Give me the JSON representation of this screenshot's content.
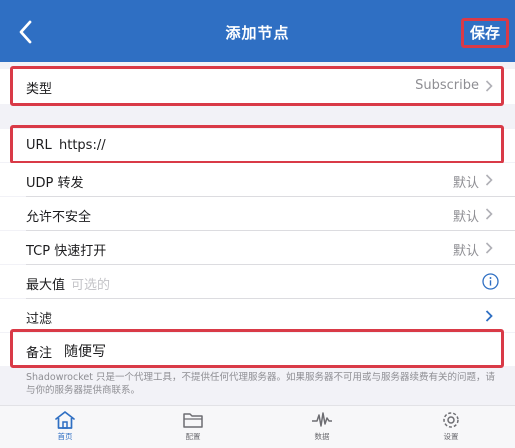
{
  "nav": {
    "title": "添加节点",
    "save_label": "保存"
  },
  "type_row": {
    "label": "类型",
    "value": "Subscribe"
  },
  "url_row": {
    "label": "URL",
    "value": "https://"
  },
  "udp_row": {
    "label": "UDP 转发",
    "value": "默认"
  },
  "insecure_row": {
    "label": "允许不安全",
    "value": "默认"
  },
  "tcp_row": {
    "label": "TCP 快速打开",
    "value": "默认"
  },
  "max_row": {
    "label": "最大值",
    "placeholder": "可选的"
  },
  "filter_row": {
    "label": "过滤"
  },
  "remark_row": {
    "label": "备注",
    "value": "随便写"
  },
  "footer_note": "Shadowrocket 只是一个代理工具，不提供任何代理服务器。如果服务器不可用或与服务器续费有关的问题，请与你的服务器提供商联系。",
  "tabs": [
    {
      "label": "首页",
      "icon": "home-icon",
      "active": true
    },
    {
      "label": "配置",
      "icon": "folder-icon",
      "active": false
    },
    {
      "label": "数据",
      "icon": "pulse-icon",
      "active": false
    },
    {
      "label": "设置",
      "icon": "gear-icon",
      "active": false
    }
  ],
  "colors": {
    "nav_blue": "#2f6fc3",
    "highlight_red": "#d93a47",
    "accent_blue": "#2f6fc3"
  }
}
